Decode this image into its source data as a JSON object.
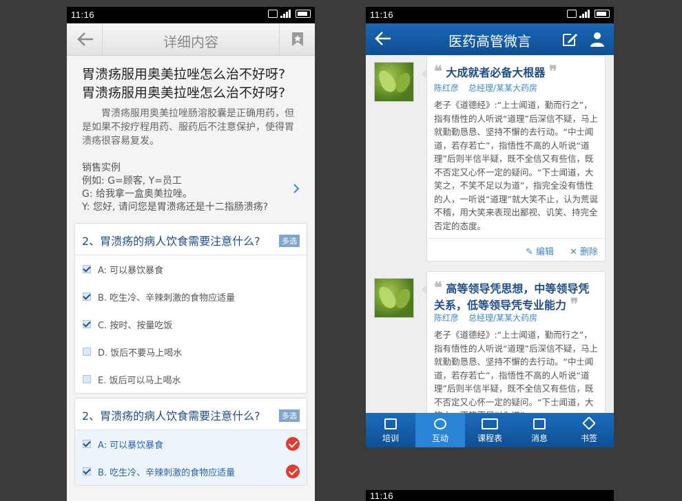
{
  "left_screen": {
    "status_time": "11:16",
    "header_title": "详细内容",
    "article_title": "胃溃疡服用奥美拉唑怎么治不好呀? 胃溃疡服用奥美拉唑怎么治不好呀?",
    "article_para": "胃溃疡服用奥美拉唑肠溶胶囊是正确用药，但是如果不按疗程用药、服药后不注意保护，使得胃溃疡很容易复发。",
    "sale_heading": "销售实例",
    "sale_lines": [
      "例如: G=顾客, Y=员工",
      "G: 给我拿一盒奥美拉唑。",
      "Y: 您好, 请问您是胃溃疡还是十二指肠溃疡?"
    ],
    "question1": {
      "title": "2、胃溃疡的病人饮食需要注意什么?",
      "tag": "多选",
      "options": [
        {
          "label": "A: 可以暴饮暴食",
          "checked": true
        },
        {
          "label": "B. 吃生冷、辛辣刺激的食物应适量",
          "checked": true
        },
        {
          "label": "C. 按时、按量吃饭",
          "checked": true
        },
        {
          "label": "D. 饭后不要马上喝水",
          "checked": false
        },
        {
          "label": "E. 饭后可以马上喝水",
          "checked": false
        }
      ]
    },
    "question2": {
      "title": "2、胃溃疡的病人饮食需要注意什么?",
      "tag": "多选",
      "options": [
        {
          "label": "A: 可以暴饮暴食",
          "checked": true,
          "correct": true
        },
        {
          "label": "B. 吃生冷、辛辣刺激的食物应适量",
          "checked": true,
          "correct": true
        }
      ]
    }
  },
  "right_screen": {
    "status_time": "11:16",
    "header_title": "医药高管微言",
    "posts": [
      {
        "title": "大成就者必备大根器",
        "author": "陈红彦",
        "role": "总经理/某某大药房",
        "body": "老子《道德经》:“上士闻道，勤而行之”，指有悟性的人听说“道理”后深信不疑，马上就勤勤恳恳、坚持不懈的去行动。“中士闻道，若存若亡”，指悟性不高的人听说“道理”后则半信半疑，既不全信又有些信，既不否定又心怀一定的疑问。“下士闻道，大笑之，不笑不足以为道”，指完全没有悟性的人，一听说“道理”就大笑不止，认为荒诞不稽，用大笑来表现出鄙视、讥笑、持完全否定的态度。",
        "edit_label": "编辑",
        "delete_label": "删除"
      },
      {
        "title": "高等领导凭思想，中等领导凭关系，低等领导凭专业能力",
        "author": "陈红彦",
        "role": "总经理/某某大药房",
        "body": "老子《道德经》:“上士闻道，勤而行之”，指有悟性的人听说“道理”后深信不疑，马上就勤勤恳恳、坚持不懈的去行动。“中士闻道，若存若亡”，指悟性不高的人听说“道理”后则半信半疑，既不全信又有些信，既不否定又心怀一定的疑问。“下士闻道，大笑之，不笑不足以为道”"
      }
    ],
    "tabs": [
      "培训",
      "互动",
      "课程表",
      "消息",
      "书签"
    ],
    "active_tab": "互动"
  },
  "third_screen": {
    "status_time": "11:16"
  },
  "colors": {
    "brand_blue": "#0f4f94",
    "link_blue": "#3f86c9",
    "correct_red": "#e23b2f"
  }
}
